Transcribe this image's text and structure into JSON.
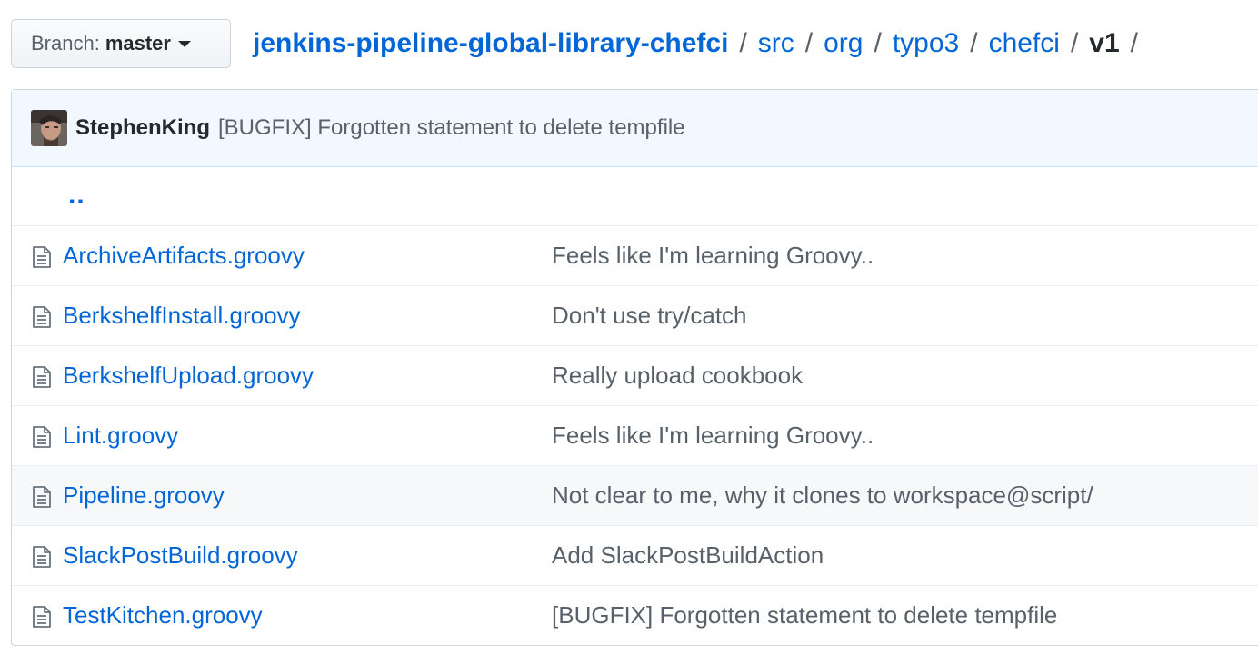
{
  "branch": {
    "label": "Branch:",
    "value": "master"
  },
  "breadcrumb": {
    "repo": "jenkins-pipeline-global-library-chefci",
    "parts": [
      "src",
      "org",
      "typo3",
      "chefci"
    ],
    "current": "v1",
    "separator": "/"
  },
  "latest_commit": {
    "author": "StephenKing",
    "message": "[BUGFIX] Forgotten statement to delete tempfile"
  },
  "parent_link": "..",
  "files": [
    {
      "name": "ArchiveArtifacts.groovy",
      "message": "Feels like I'm learning Groovy..",
      "icon": "file-icon"
    },
    {
      "name": "BerkshelfInstall.groovy",
      "message": "Don't use try/catch",
      "icon": "file-icon"
    },
    {
      "name": "BerkshelfUpload.groovy",
      "message": "Really upload cookbook",
      "icon": "file-icon"
    },
    {
      "name": "Lint.groovy",
      "message": "Feels like I'm learning Groovy..",
      "icon": "file-icon"
    },
    {
      "name": "Pipeline.groovy",
      "message": "Not clear to me, why it clones to workspace@script/",
      "icon": "file-icon",
      "hovered": true
    },
    {
      "name": "SlackPostBuild.groovy",
      "message": "Add SlackPostBuildAction",
      "icon": "file-icon"
    },
    {
      "name": "TestKitchen.groovy",
      "message": "[BUGFIX] Forgotten statement to delete tempfile",
      "icon": "file-icon"
    }
  ],
  "colors": {
    "link": "#0366d6",
    "muted": "#586069",
    "commit_bg": "#f1f8ff",
    "hover_bg": "#f6f8fa"
  }
}
